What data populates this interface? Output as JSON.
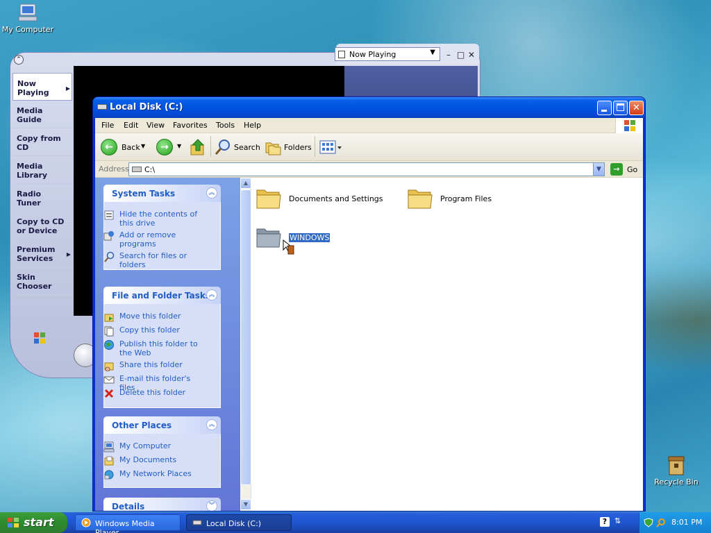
{
  "desktop": {
    "icons": {
      "my_computer": "My Computer",
      "recycle_bin": "Recycle Bin"
    }
  },
  "wmp": {
    "now_playing_combo": "Now Playing",
    "nav": [
      {
        "label": "Now\nPlaying",
        "selected": true,
        "arrow": true
      },
      {
        "label": "Media\nGuide",
        "selected": false,
        "arrow": false
      },
      {
        "label": "Copy from\nCD",
        "selected": false,
        "arrow": false
      },
      {
        "label": "Media\nLibrary",
        "selected": false,
        "arrow": false
      },
      {
        "label": "Radio\nTuner",
        "selected": false,
        "arrow": false
      },
      {
        "label": "Copy to CD\nor Device",
        "selected": false,
        "arrow": false
      },
      {
        "label": "Premium\nServices",
        "selected": false,
        "arrow": true
      },
      {
        "label": "Skin\nChooser",
        "selected": false,
        "arrow": false
      }
    ]
  },
  "explorer": {
    "title": "Local Disk (C:)",
    "menu": [
      "File",
      "Edit",
      "View",
      "Favorites",
      "Tools",
      "Help"
    ],
    "toolbar": {
      "back": "Back",
      "search": "Search",
      "folders": "Folders"
    },
    "address": {
      "label": "Address",
      "value": "C:\\",
      "go": "Go"
    },
    "system_tasks": {
      "title": "System Tasks",
      "items": [
        "Hide the contents of this drive",
        "Add or remove programs",
        "Search for files or folders"
      ]
    },
    "file_folder_tasks": {
      "title": "File and Folder Tasks",
      "items": [
        "Move this folder",
        "Copy this folder",
        "Publish this folder to the Web",
        "Share this folder",
        "E-mail this folder's files",
        "Delete this folder"
      ]
    },
    "other_places": {
      "title": "Other Places",
      "items": [
        "My Computer",
        "My Documents",
        "My Network Places"
      ]
    },
    "details": {
      "title": "Details"
    },
    "items": [
      {
        "name": "Documents and Settings",
        "selected": false
      },
      {
        "name": "Program Files",
        "selected": false
      },
      {
        "name": "WINDOWS",
        "selected": true
      }
    ]
  },
  "taskbar": {
    "start": "start",
    "buttons": [
      {
        "label": "Windows Media Player",
        "active": false
      },
      {
        "label": "Local Disk (C:)",
        "active": true
      }
    ],
    "clock": "8:01 PM"
  },
  "colors": {
    "title_blue": "#0054e3",
    "task_link": "#215dc6",
    "selection": "#316ac5",
    "start_green": "#2e8b2e"
  }
}
